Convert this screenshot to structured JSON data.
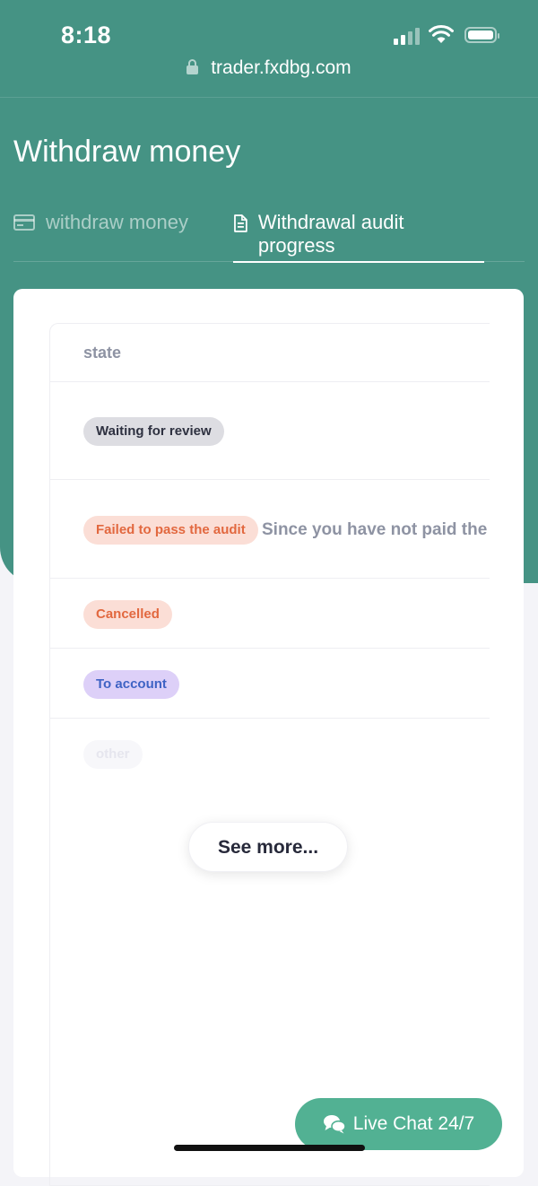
{
  "status_bar": {
    "time": "8:18"
  },
  "browser": {
    "url": "trader.fxdbg.com"
  },
  "page": {
    "title": "Withdraw money"
  },
  "tabs": [
    {
      "label": "withdraw money",
      "icon": "credit-card-icon",
      "active": false
    },
    {
      "label": "Withdrawal audit progress",
      "icon": "document-icon",
      "active": true
    }
  ],
  "table": {
    "header": {
      "state": "state"
    },
    "rows": [
      {
        "status": "Waiting for review",
        "reason": ""
      },
      {
        "status": "Failed to pass the audit",
        "reason": "Since you have not paid the"
      },
      {
        "status": "Cancelled",
        "reason": ""
      },
      {
        "status": "To account",
        "reason": ""
      },
      {
        "status": "other",
        "reason": ""
      }
    ]
  },
  "see_more": {
    "label": "See more..."
  },
  "live_chat": {
    "label": "Live Chat 24/7",
    "icon": "chat-bubbles-icon"
  },
  "colors": {
    "brand": "#459384",
    "chat_button": "#52b193",
    "failed_text": "#e2683f",
    "to_account_text": "#3f63c4"
  }
}
